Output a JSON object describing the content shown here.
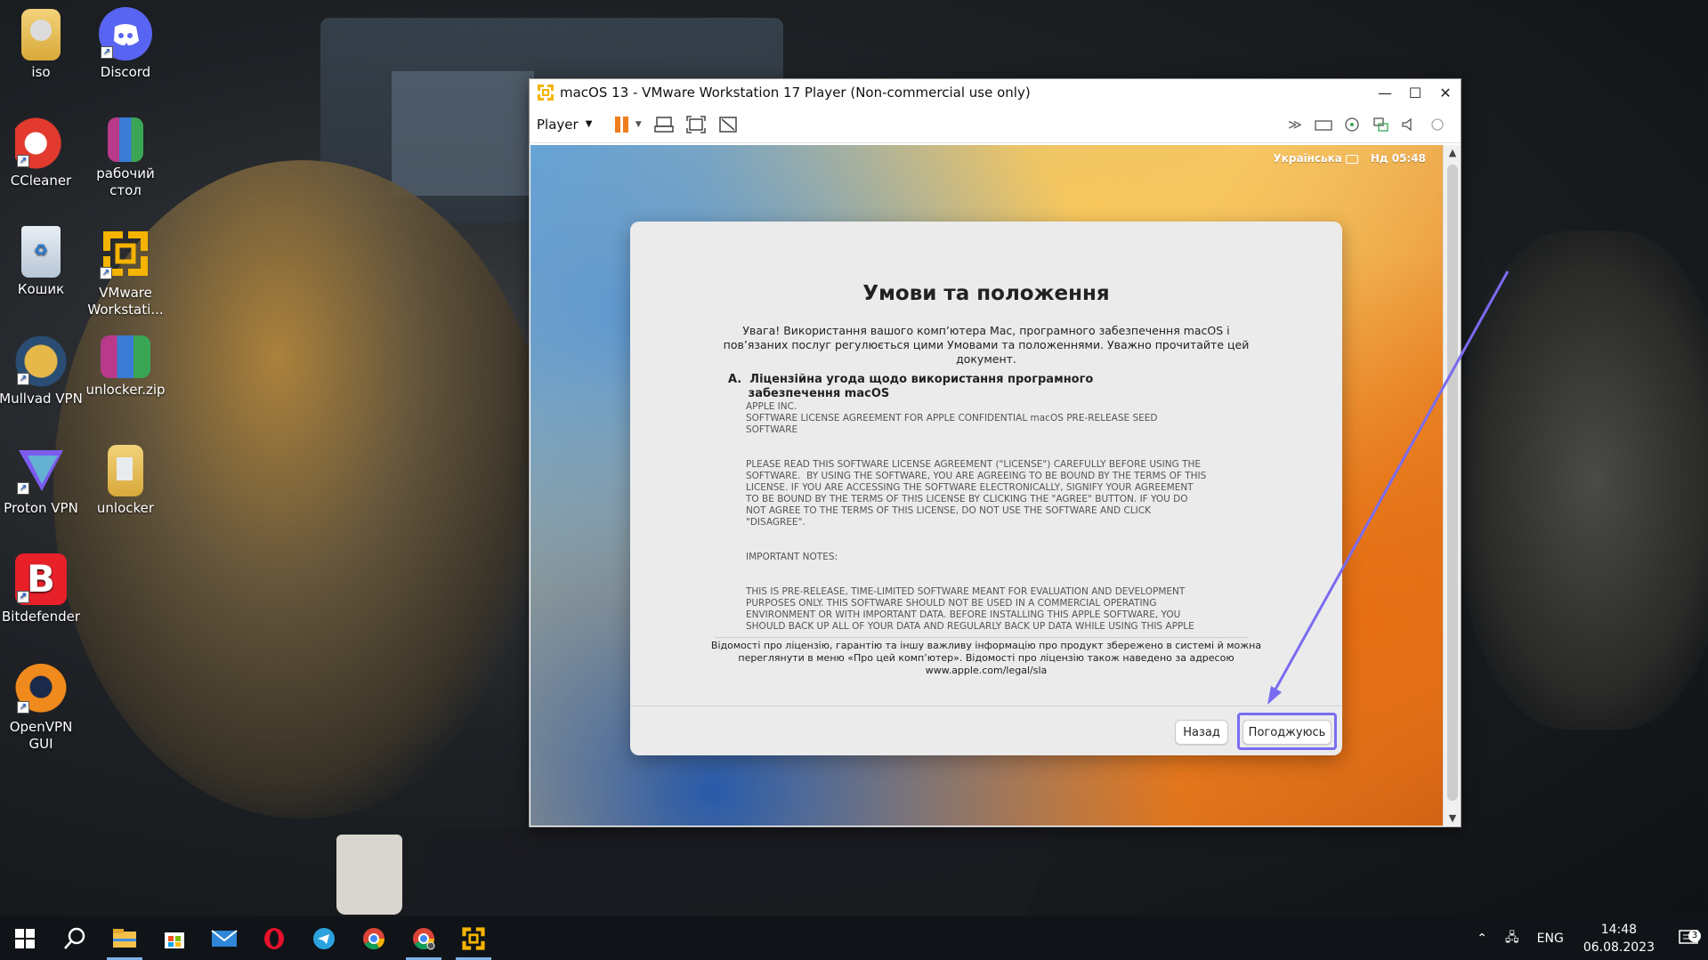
{
  "desktop": {
    "icons": [
      {
        "label": "iso",
        "icon": "folder-icon"
      },
      {
        "label": "Discord",
        "icon": "discord-icon"
      },
      {
        "label": "CCleaner",
        "icon": "ccleaner-icon"
      },
      {
        "label": "рабочий стол",
        "icon": "winrar-archive-icon"
      },
      {
        "label": "Кошик",
        "icon": "recycle-bin-icon"
      },
      {
        "label": "VMware Workstati...",
        "icon": "vmware-icon"
      },
      {
        "label": "Mullvad VPN",
        "icon": "mullvad-icon"
      },
      {
        "label": "unlocker.zip",
        "icon": "winrar-archive-icon"
      },
      {
        "label": "Proton VPN",
        "icon": "protonvpn-icon"
      },
      {
        "label": "unlocker",
        "icon": "folder-icon"
      },
      {
        "label": "Bitdefender",
        "icon": "bitdefender-icon"
      },
      {
        "label": "OpenVPN GUI",
        "icon": "openvpn-icon"
      }
    ]
  },
  "vmware": {
    "title": "macOS 13 - VMware Workstation 17 Player (Non-commercial use only)",
    "player_menu": "Player",
    "window_controls": [
      "—",
      "☐",
      "✕"
    ]
  },
  "macos": {
    "menubar": {
      "language": "Українська",
      "clock": "Нд 05:48"
    },
    "dialog": {
      "title": "Умови та положення",
      "intro": "Увага! Використання вашого комп’ютера Mac, програмного забезпечення macOS і пов’язаних послуг регулюється цими Умовами та положеннями. Уважно прочитайте цей документ.",
      "section_heading": "A.  Ліцензійна угода щодо використання програмного\n     забезпечення macOS",
      "license_text": "APPLE INC.\nSOFTWARE LICENSE AGREEMENT FOR APPLE CONFIDENTIAL macOS PRE-RELEASE SEED\nSOFTWARE\n\n\nPLEASE READ THIS SOFTWARE LICENSE AGREEMENT (\"LICENSE\") CAREFULLY BEFORE USING THE\nSOFTWARE.  BY USING THE SOFTWARE, YOU ARE AGREEING TO BE BOUND BY THE TERMS OF THIS\nLICENSE. IF YOU ARE ACCESSING THE SOFTWARE ELECTRONICALLY, SIGNIFY YOUR AGREEMENT\nTO BE BOUND BY THE TERMS OF THIS LICENSE BY CLICKING THE \"AGREE\" BUTTON. IF YOU DO\nNOT AGREE TO THE TERMS OF THIS LICENSE, DO NOT USE THE SOFTWARE AND CLICK\n\"DISAGREE\".\n\n\nIMPORTANT NOTES:\n\n\nTHIS IS PRE-RELEASE, TIME-LIMITED SOFTWARE MEANT FOR EVALUATION AND DEVELOPMENT\nPURPOSES ONLY. THIS SOFTWARE SHOULD NOT BE USED IN A COMMERCIAL OPERATING\nENVIRONMENT OR WITH IMPORTANT DATA. BEFORE INSTALLING THIS APPLE SOFTWARE, YOU\nSHOULD BACK UP ALL OF YOUR DATA AND REGULARLY BACK UP DATA WHILE USING THIS APPLE",
      "footer": "Відомості про ліцензію, гарантію та іншу важливу інформацію про продукт збережено в системі й можна переглянути в меню «Про цей комп’ютер». Відомості про ліцензію також наведено за адресою www.apple.com/legal/sla",
      "back_button": "Назад",
      "agree_button": "Погоджуюсь"
    }
  },
  "taskbar": {
    "items": [
      "start-icon",
      "search-icon",
      "file-explorer-icon",
      "store-icon",
      "mail-icon",
      "opera-icon",
      "telegram-icon",
      "chrome-icon",
      "chrome-profile-icon",
      "vmware-icon"
    ],
    "language": "ENG",
    "time": "14:48",
    "date": "06.08.2023",
    "notification_count": "3"
  },
  "colors": {
    "highlight": "#7a6cf0",
    "taskbar": "#101418"
  }
}
